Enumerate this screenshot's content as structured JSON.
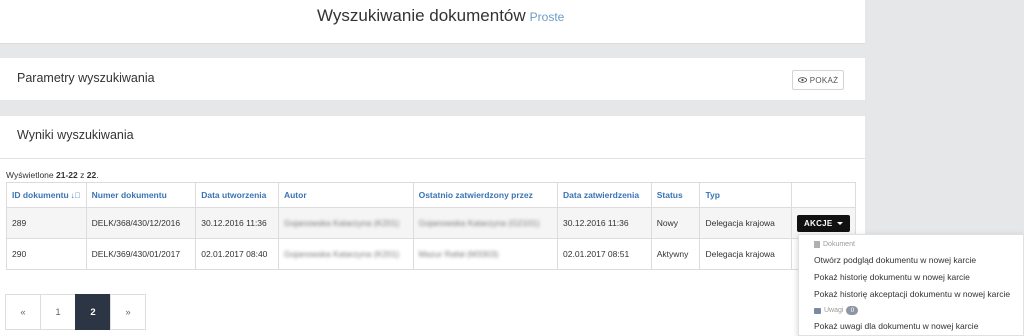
{
  "header": {
    "title": "Wyszukiwanie dokumentów",
    "subtitle": "Proste"
  },
  "params": {
    "heading": "Parametry wyszukiwania",
    "show_button": "POKAŻ"
  },
  "results": {
    "heading": "Wyniki wyszukiwania",
    "shown_prefix": "Wyświetlone ",
    "shown_range": "21-22",
    "shown_of": " z ",
    "shown_total": "22",
    "shown_suffix": ".",
    "columns": [
      "ID dokumentu",
      "Numer dokumentu",
      "Data utworzenia",
      "Autor",
      "Ostatnio zatwierdzony przez",
      "Data zatwierdzenia",
      "Status",
      "Typ",
      ""
    ],
    "rows": [
      {
        "id": "289",
        "number": "DELK/368/430/12/2016",
        "created": "30.12.2016 11:36",
        "author": "Gojanowska Katarzyna (K201)",
        "approver": "Gojanowska Katarzyna (G2101)",
        "approved": "30.12.2016 11:36",
        "status": "Nowy",
        "type": "Delegacja krajowa",
        "action": "AKCJE"
      },
      {
        "id": "290",
        "number": "DELK/369/430/01/2017",
        "created": "02.01.2017 08:40",
        "author": "Gojanowska Katarzyna (K201)",
        "approver": "Mazur Rafał (M3303)",
        "approved": "02.01.2017 08:51",
        "status": "Aktywny",
        "type": "Delegacja krajowa",
        "action": ""
      }
    ]
  },
  "pagination": {
    "prev": "«",
    "pages": [
      "1",
      "2"
    ],
    "active": "2",
    "next": "»"
  },
  "dropdown": {
    "section_document": "Dokument",
    "open_preview": "Otwórz podgląd dokumentu w nowej karcie",
    "history": "Pokaż historię dokumentu w nowej karcie",
    "approval_history": "Pokaż historię akceptacji dokumentu w nowej karcie",
    "section_notes": "Uwagi",
    "notes_count": "0",
    "show_notes": "Pokaż uwagi dla dokumentu w nowej karcie"
  },
  "colors": {
    "accent": "#3a74b3",
    "active_page": "#2c3544",
    "button_dark": "#111111",
    "background": "#e6e7e9"
  }
}
